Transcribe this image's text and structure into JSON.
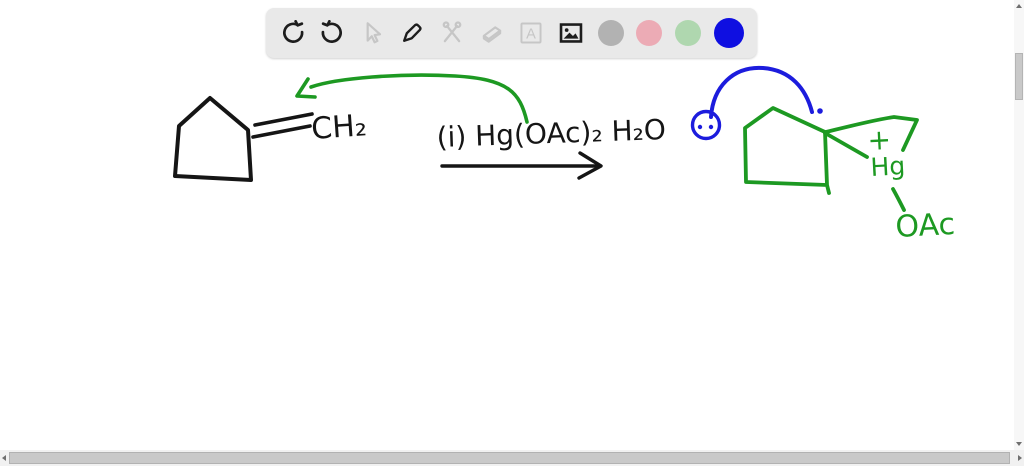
{
  "toolbar": {
    "background": "#e9e9e9",
    "tools": [
      {
        "name": "undo",
        "state": "enabled"
      },
      {
        "name": "redo",
        "state": "enabled"
      },
      {
        "name": "select-cursor",
        "state": "disabled"
      },
      {
        "name": "pen",
        "state": "enabled"
      },
      {
        "name": "shape-tools",
        "state": "disabled"
      },
      {
        "name": "eraser",
        "state": "disabled"
      },
      {
        "name": "text",
        "state": "disabled",
        "glyph": "A"
      },
      {
        "name": "insert-image",
        "state": "enabled"
      }
    ],
    "colors": [
      {
        "name": "gray",
        "hex": "#b2b2b2",
        "selected": false
      },
      {
        "name": "pink",
        "hex": "#ecabb5",
        "selected": false
      },
      {
        "name": "green",
        "hex": "#afd7af",
        "selected": false
      },
      {
        "name": "blue",
        "hex": "#0f0fe1",
        "selected": true
      }
    ]
  },
  "whiteboard": {
    "reaction": {
      "reactant_label": "CH₂",
      "reagent_text": "(i) Hg(OAc)₂ H₂O",
      "product_charge": "+",
      "product_metal": "Hg",
      "product_ligand": "OAc"
    },
    "ink": {
      "black": "#151515",
      "green": "#1d9922",
      "blue": "#1c1cdd"
    }
  }
}
